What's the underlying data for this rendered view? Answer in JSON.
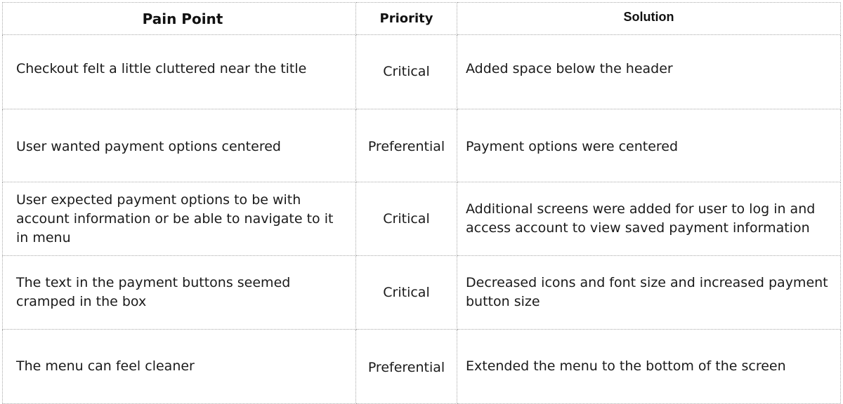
{
  "table": {
    "headers": [
      "Pain Point",
      "Priority",
      "Solution"
    ],
    "rows": [
      {
        "pain_point": "Checkout felt a little cluttered near the title",
        "priority": "Critical",
        "solution": "Added space below the header"
      },
      {
        "pain_point": "User wanted payment options centered",
        "priority": "Preferential",
        "solution": "Payment options were centered"
      },
      {
        "pain_point": "User expected payment options to be with account information or be able to navigate to it in menu",
        "priority": "Critical",
        "solution": "Additional screens were added for user to log in and access account to view saved payment information"
      },
      {
        "pain_point": "The text in the payment buttons seemed cramped in the box",
        "priority": "Critical",
        "solution": "Decreased icons and font size and increased payment button size"
      },
      {
        "pain_point": "The menu can feel cleaner",
        "priority": "Preferential",
        "solution": "Extended the menu to the bottom of the screen"
      }
    ]
  }
}
